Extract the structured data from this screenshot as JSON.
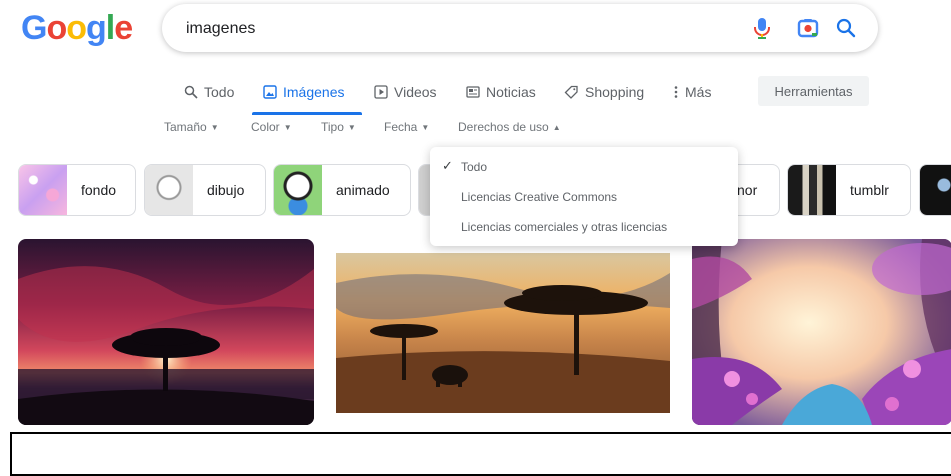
{
  "logo": {
    "text": "Google",
    "letters": [
      "G",
      "o",
      "o",
      "g",
      "l",
      "e"
    ],
    "colors": [
      "#4285f4",
      "#ea4335",
      "#fbbc05",
      "#4285f4",
      "#34a853",
      "#ea4335"
    ]
  },
  "search": {
    "query": "imagenes",
    "icons": {
      "voice": "microphone-icon",
      "lens": "camera-lens-icon",
      "search": "search-icon"
    }
  },
  "tabs": [
    {
      "label": "Todo",
      "icon": "search-icon"
    },
    {
      "label": "Imágenes",
      "icon": "image-icon",
      "active": true
    },
    {
      "label": "Videos",
      "icon": "play-icon"
    },
    {
      "label": "Noticias",
      "icon": "news-icon"
    },
    {
      "label": "Shopping",
      "icon": "tag-icon"
    },
    {
      "label": "Más",
      "icon": "more-vertical-icon"
    }
  ],
  "tools_label": "Herramientas",
  "filters": [
    "Tamaño",
    "Color",
    "Tipo",
    "Fecha",
    "Derechos de uso"
  ],
  "chips": [
    "fondo",
    "dibujo",
    "animado",
    "nor",
    "tumblr"
  ],
  "dropdown": {
    "items": [
      "Todo",
      "Licencias Creative Commons",
      "Licencias comerciales y otras licencias"
    ],
    "selected": "Todo"
  },
  "colors": {
    "accent": "#1a73e8",
    "muted": "#5f6368"
  }
}
